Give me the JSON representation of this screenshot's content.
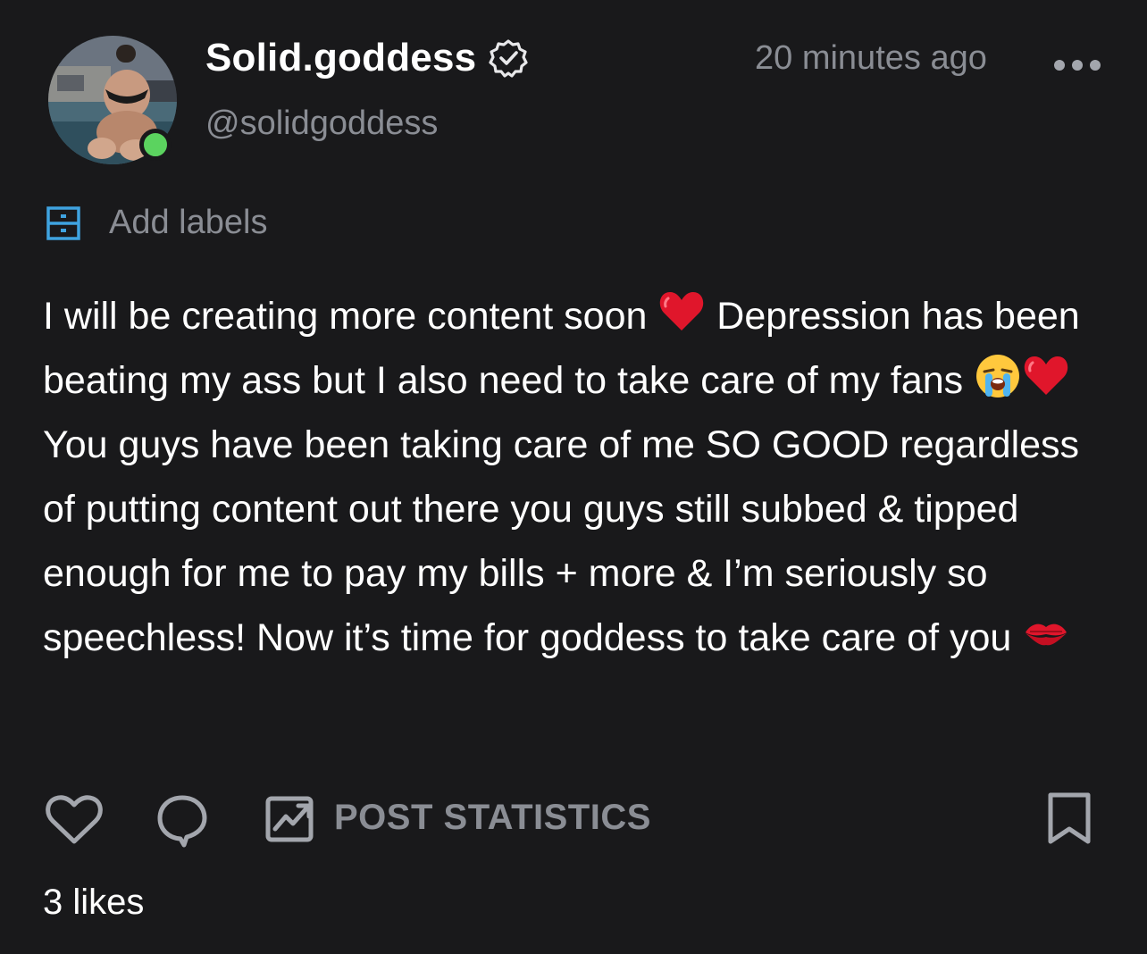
{
  "header": {
    "display_name": "Solid.goddess",
    "handle": "@solidgoddess",
    "timestamp": "20 minutes ago",
    "verified_icon": "verified-badge-icon",
    "online_status_color": "#5bd35f",
    "more_icon": "more-dots-icon"
  },
  "labels": {
    "add_label": "Add labels",
    "icon": "label-icon",
    "icon_color": "#3fa3e0"
  },
  "post": {
    "segments": [
      {
        "text": "I will be creating more content soon "
      },
      {
        "emoji": "red-heart"
      },
      {
        "text": " Depression has been beating my ass but I also need to take care of my fans "
      },
      {
        "emoji": "loudly-crying-face"
      },
      {
        "emoji": "red-heart"
      },
      {
        "text": " You guys have been taking care of me SO GOOD regardless of putting content out there you guys still subbed & tipped enough for me to pay my bills + more & I’m seriously so speechless! Now it’s time for goddess to take care of you "
      },
      {
        "emoji": "kiss-mark"
      }
    ]
  },
  "actions": {
    "like_icon": "heart-outline-icon",
    "comment_icon": "comment-bubble-icon",
    "stats_icon": "statistics-chart-icon",
    "stats_label": "POST STATISTICS",
    "bookmark_icon": "bookmark-icon"
  },
  "likes_count": "3 likes",
  "colors": {
    "background": "#19191b",
    "primary_text": "#ffffff",
    "secondary_text": "#8a8d94",
    "accent": "#3fa3e0"
  }
}
